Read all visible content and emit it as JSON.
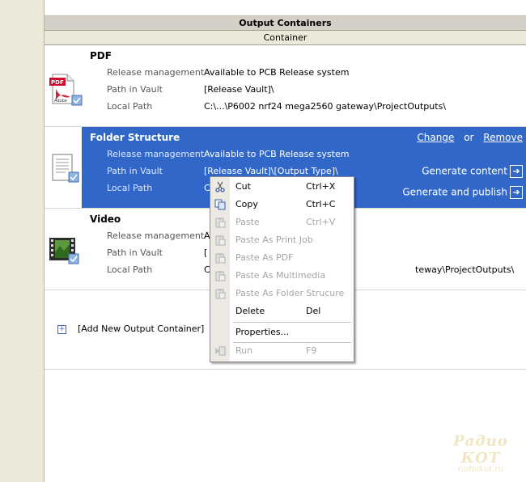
{
  "header": {
    "title": "Output Containers",
    "column": "Container"
  },
  "labels": {
    "release_management": "Release management",
    "path_in_vault": "Path in Vault",
    "local_path": "Local Path"
  },
  "containers": [
    {
      "name": "PDF",
      "icon": "pdf-document-icon",
      "release_management": "Available to PCB Release system",
      "path_in_vault": "[Release Vault]\\",
      "local_path": "C:\\...\\P6002 nrf24 mega2560 gateway\\ProjectOutputs\\"
    },
    {
      "name": "Folder Structure",
      "icon": "folder-structure-icon",
      "release_management": "Available to PCB Release system",
      "path_in_vault": "[Release Vault]\\[Output Type]\\",
      "local_path": "C",
      "actions": {
        "change": "Change",
        "or": "or",
        "remove": "Remove",
        "generate_content": "Generate content",
        "generate_and_publish": "Generate and publish"
      }
    },
    {
      "name": "Video",
      "icon": "video-film-icon",
      "release_management": "A",
      "path_in_vault": "[",
      "local_path": "C",
      "local_path_tail": "teway\\ProjectOutputs\\"
    }
  ],
  "add_container": "[Add New Output Container]",
  "context_menu": {
    "items": [
      {
        "label": "Cut",
        "shortcut": "Ctrl+X",
        "enabled": true,
        "icon": "cut-icon"
      },
      {
        "label": "Copy",
        "shortcut": "Ctrl+C",
        "enabled": true,
        "icon": "copy-icon"
      },
      {
        "label": "Paste",
        "shortcut": "Ctrl+V",
        "enabled": false,
        "icon": "paste-icon"
      },
      {
        "label": "Paste As Print Job",
        "shortcut": "",
        "enabled": false,
        "icon": "paste-icon"
      },
      {
        "label": "Paste As PDF",
        "shortcut": "",
        "enabled": false,
        "icon": "paste-icon"
      },
      {
        "label": "Paste As Multimedia",
        "shortcut": "",
        "enabled": false,
        "icon": "paste-icon"
      },
      {
        "label": "Paste As Folder Strucure",
        "shortcut": "",
        "enabled": false,
        "icon": "paste-icon"
      },
      {
        "label": "Delete",
        "shortcut": "Del",
        "enabled": true,
        "icon": ""
      },
      {
        "label": "Properties...",
        "shortcut": "",
        "enabled": true,
        "icon": ""
      },
      {
        "label": "Run",
        "shortcut": "F9",
        "enabled": false,
        "icon": "run-icon"
      }
    ]
  },
  "watermark": {
    "title": "Радио КОТ",
    "site": "radiokot.ru"
  },
  "colors": {
    "selection": "#3167c9",
    "header_bg": "#d4d0c8",
    "menu_gutter": "#eceae3"
  }
}
